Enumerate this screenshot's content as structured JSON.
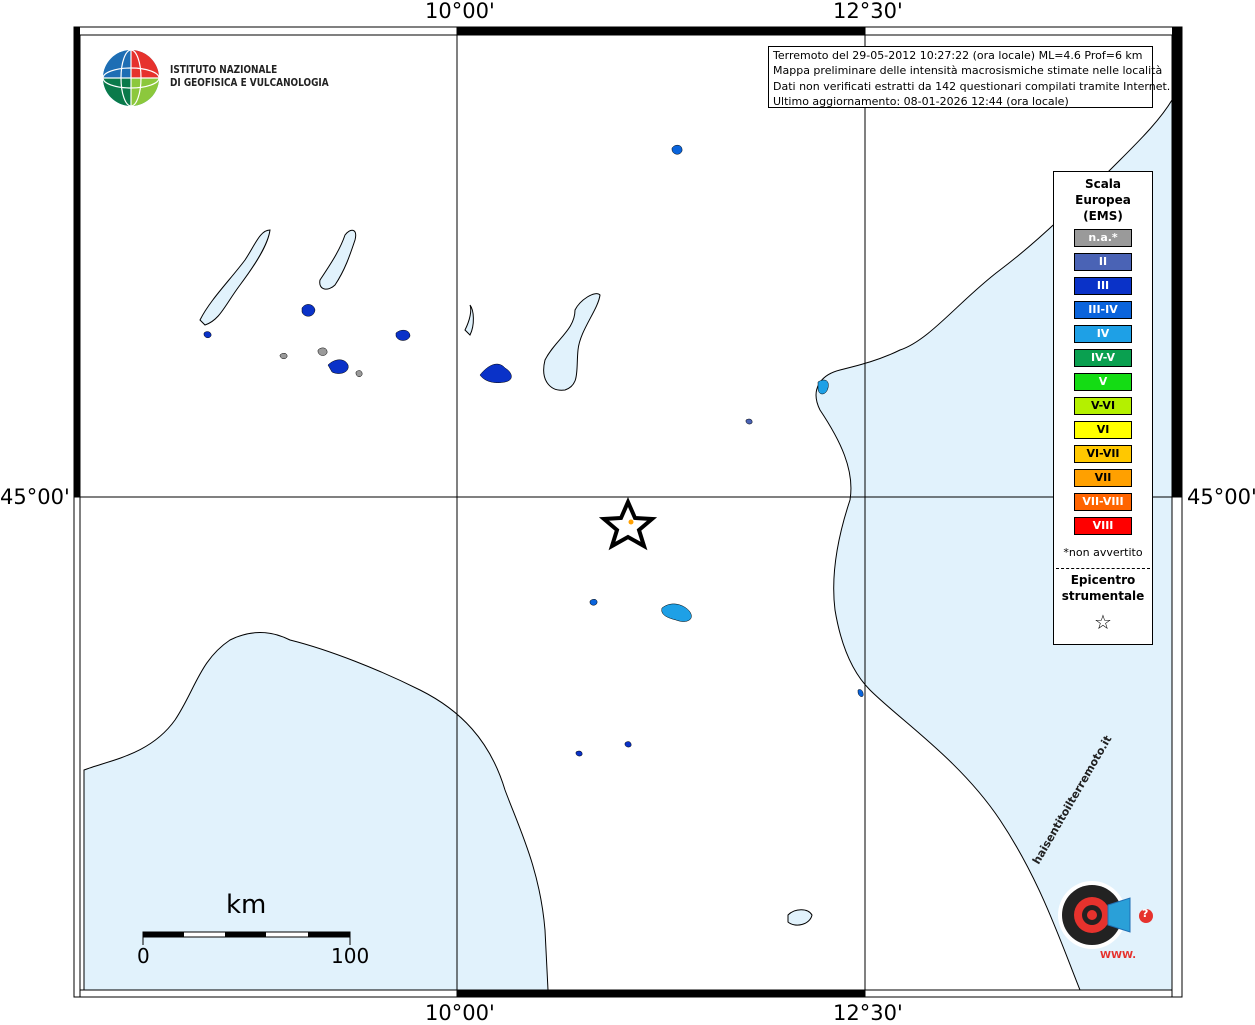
{
  "grid_labels": {
    "top_left": "10°00'",
    "top_right": "12°30'",
    "bottom_left": "10°00'",
    "bottom_right": "12°30'",
    "left": "45°00'",
    "right": "45°00'"
  },
  "logo": {
    "line1": "ISTITUTO NAZIONALE",
    "line2": "DI GEOFISICA E VULCANOLOGIA"
  },
  "info_box": {
    "line1": "Terremoto del 29-05-2012 10:27:22 (ora locale) ML=4.6 Prof=6 km",
    "line2": "Mappa preliminare delle intensità macrosismiche stimate nelle località",
    "line3": "Dati non verificati estratti da 142 questionari compilati tramite Internet.",
    "line4": "Ultimo aggiornamento: 08-01-2026 12:44 (ora locale)"
  },
  "legend": {
    "title": "Scala Europea (EMS)",
    "title_l1": "Scala",
    "title_l2": "Europea",
    "title_l3": "(EMS)",
    "items": [
      {
        "label": "n.a.*",
        "color": "#9a9a9a"
      },
      {
        "label": "II",
        "color": "#4a63b5"
      },
      {
        "label": "III",
        "color": "#0a32c8"
      },
      {
        "label": "III-IV",
        "color": "#0a64dc"
      },
      {
        "label": "IV",
        "color": "#1ea0e6"
      },
      {
        "label": "IV-V",
        "color": "#0aa050"
      },
      {
        "label": "V",
        "color": "#14dc14"
      },
      {
        "label": "V-VI",
        "color": "#b4f000"
      },
      {
        "label": "VI",
        "color": "#ffff00"
      },
      {
        "label": "VI-VII",
        "color": "#ffc800"
      },
      {
        "label": "VII",
        "color": "#ffa000"
      },
      {
        "label": "VII-VIII",
        "color": "#ff6400"
      },
      {
        "label": "VIII",
        "color": "#ff0000"
      }
    ],
    "note": "*non avvertito",
    "epicenter_l1": "Epicentro",
    "epicenter_l2": "strumentale",
    "star": "☆"
  },
  "scale_bar": {
    "unit": "km",
    "min": "0",
    "max": "100"
  },
  "watermark": {
    "text": "haisentitoilterremoto.it",
    "url": "WWW.",
    "mark": "?"
  },
  "colors": {
    "sea": "#e1f2fc",
    "land": "#ffffff",
    "frame": "#000000"
  }
}
